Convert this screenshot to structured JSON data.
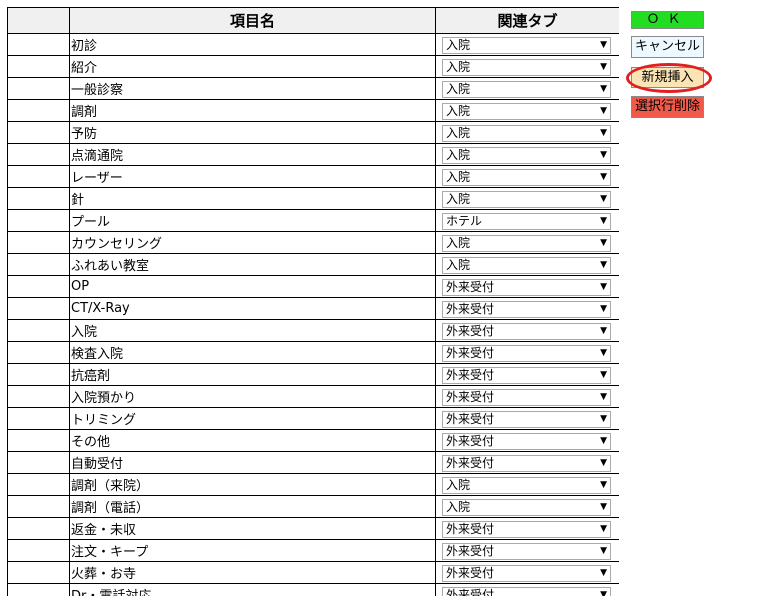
{
  "table": {
    "headers": {
      "select": "",
      "name": "項目名",
      "tab": "関連タブ"
    },
    "rows": [
      {
        "name": "初診",
        "tab": "入院"
      },
      {
        "name": "紹介",
        "tab": "入院"
      },
      {
        "name": "一般診察",
        "tab": "入院"
      },
      {
        "name": "調剤",
        "tab": "入院"
      },
      {
        "name": "予防",
        "tab": "入院"
      },
      {
        "name": "点滴通院",
        "tab": "入院"
      },
      {
        "name": "レーザー",
        "tab": "入院"
      },
      {
        "name": "針",
        "tab": "入院"
      },
      {
        "name": "プール",
        "tab": "ホテル"
      },
      {
        "name": "カウンセリング",
        "tab": "入院"
      },
      {
        "name": "ふれあい教室",
        "tab": "入院"
      },
      {
        "name": "OP",
        "tab": "外来受付"
      },
      {
        "name": "CT/X-Ray",
        "tab": "外来受付"
      },
      {
        "name": "入院",
        "tab": "外来受付"
      },
      {
        "name": "検査入院",
        "tab": "外来受付"
      },
      {
        "name": "抗癌剤",
        "tab": "外来受付"
      },
      {
        "name": "入院預かり",
        "tab": "外来受付"
      },
      {
        "name": "トリミング",
        "tab": "外来受付"
      },
      {
        "name": "その他",
        "tab": "外来受付"
      },
      {
        "name": "自動受付",
        "tab": "外来受付"
      },
      {
        "name": "調剤（来院）",
        "tab": "入院"
      },
      {
        "name": "調剤（電話）",
        "tab": "入院"
      },
      {
        "name": "返金・未収",
        "tab": "外来受付"
      },
      {
        "name": "注文・キープ",
        "tab": "外来受付"
      },
      {
        "name": "火葬・お寺",
        "tab": "外来受付"
      },
      {
        "name": "Dr・電話対応",
        "tab": "外来受付"
      }
    ]
  },
  "buttons": {
    "ok": "ＯＫ",
    "cancel": "キャンセル",
    "new_insert": "新規挿入",
    "delete_selected": "選択行削除"
  },
  "icons": {
    "dropdown": "chevron-down-icon"
  },
  "colors": {
    "ok": "#22dd22",
    "cancel": "#eef8ff",
    "new_insert": "#fbe4b4",
    "delete_selected": "#f05a4a",
    "highlight": "#e02020"
  }
}
